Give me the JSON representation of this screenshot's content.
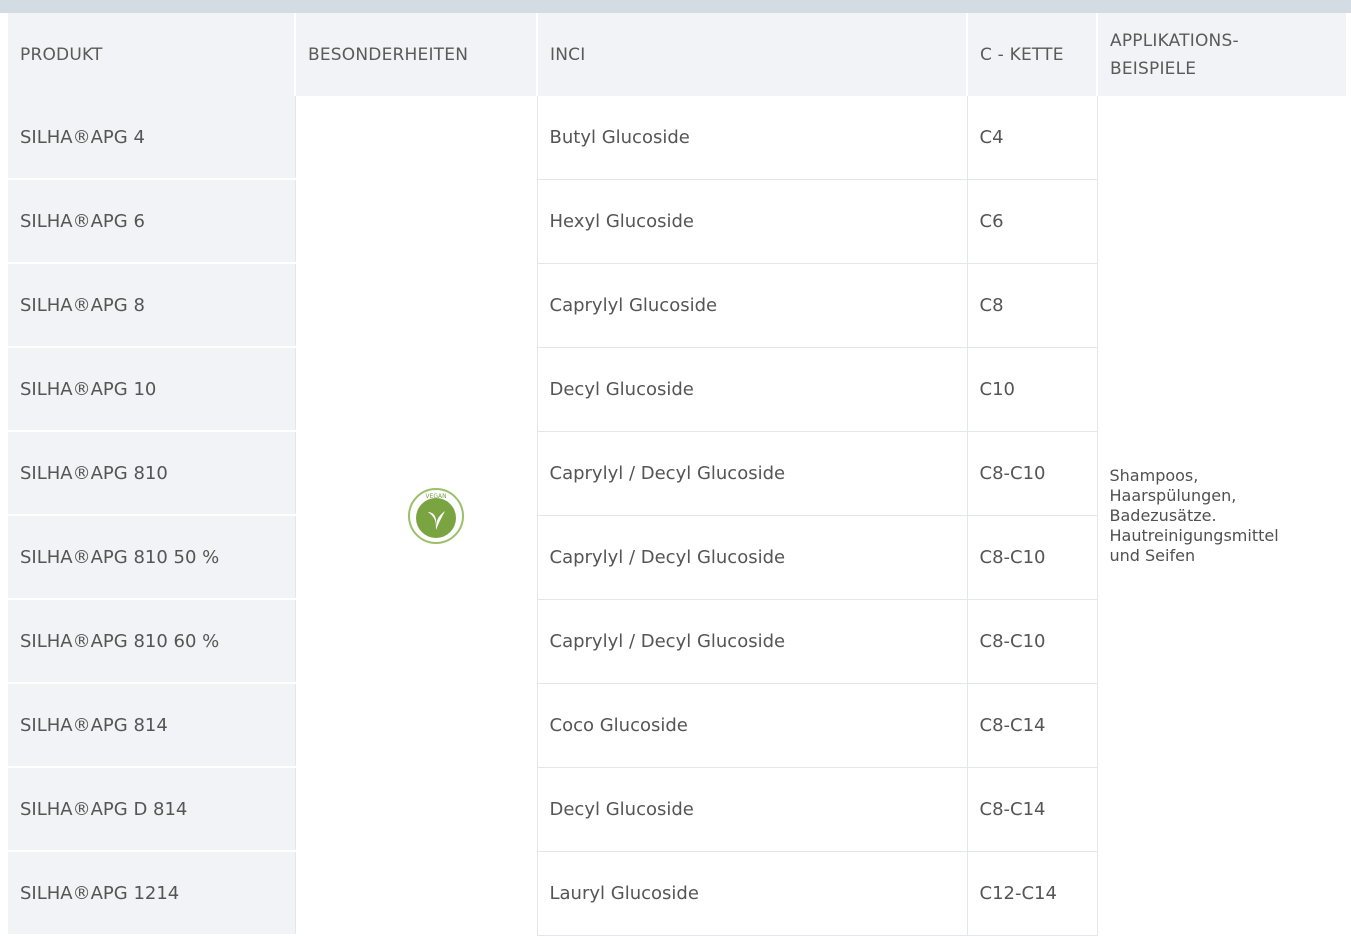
{
  "table": {
    "headers": {
      "produkt": "PRODUKT",
      "besonderheiten": "BESONDERHEITEN",
      "inci": "INCI",
      "c_kette": "C - KETTE",
      "applikation_line1": "APPLIKATIONS-",
      "applikation_line2": "BEISPIELE"
    },
    "rows": [
      {
        "produkt": "SILHA®APG 4",
        "inci": "Butyl Glucoside",
        "kette": "C4"
      },
      {
        "produkt": "SILHA®APG 6",
        "inci": "Hexyl Glucoside",
        "kette": "C6"
      },
      {
        "produkt": "SILHA®APG 8",
        "inci": "Caprylyl Glucoside",
        "kette": "C8"
      },
      {
        "produkt": "SILHA®APG 10",
        "inci": "Decyl Glucoside",
        "kette": "C10"
      },
      {
        "produkt": "SILHA®APG 810",
        "inci": "Caprylyl / Decyl Glucoside",
        "kette": "C8-C10"
      },
      {
        "produkt": "SILHA®APG 810 50 %",
        "inci": "Caprylyl / Decyl Glucoside",
        "kette": "C8-C10"
      },
      {
        "produkt": "SILHA®APG 810 60 %",
        "inci": "Caprylyl / Decyl Glucoside",
        "kette": "C8-C10"
      },
      {
        "produkt": "SILHA®APG 814",
        "inci": "Coco Glucoside",
        "kette": "C8-C14"
      },
      {
        "produkt": "SILHA®APG D 814",
        "inci": "Decyl Glucoside",
        "kette": "C8-C14"
      },
      {
        "produkt": "SILHA®APG 1214",
        "inci": "Lauryl Glucoside",
        "kette": "C12-C14"
      }
    ],
    "besonderheiten": {
      "icon": "vegan-badge-icon",
      "badge_text": "VEGAN",
      "badge_color": "#7aa342"
    },
    "applikation": [
      "Shampoos,",
      "Haarspülungen,",
      "Badezusätze.",
      "Hautreinigungsmittel",
      "und Seifen"
    ]
  },
  "colors": {
    "header_bg": "#f1f3f6",
    "topbar": "#d3dbe3",
    "border": "#e3e6ea"
  }
}
